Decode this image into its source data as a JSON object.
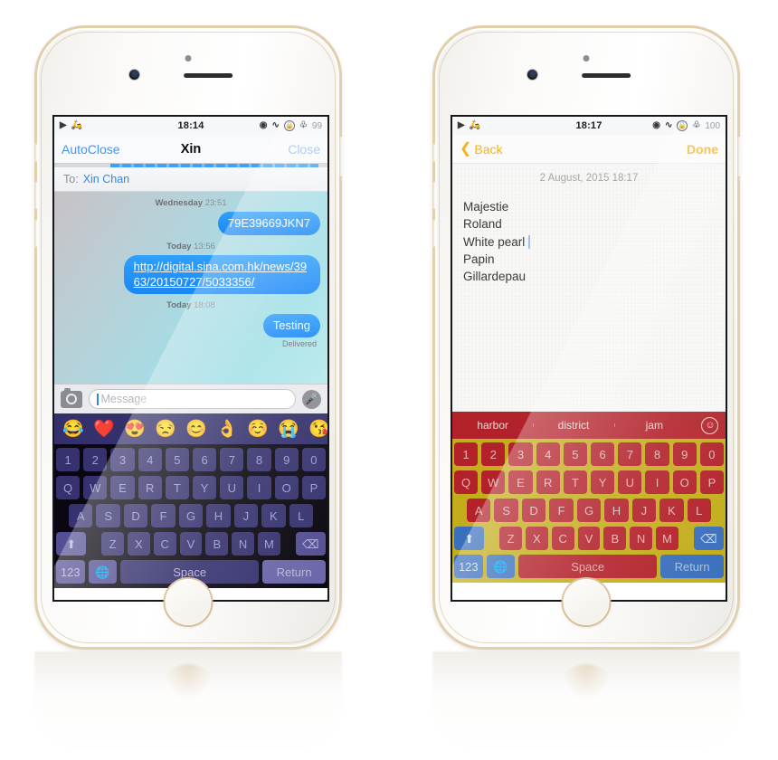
{
  "left_phone": {
    "status_bar": {
      "icons_left": [
        "location-arrow-icon",
        "scooter-icon"
      ],
      "time": "18:14",
      "icons_right": [
        "eye-icon",
        "alarm-icon",
        "rotation-lock-icon",
        "bluetooth-icon"
      ],
      "battery": "99"
    },
    "nav": {
      "left_label": "AutoClose",
      "title": "Xin",
      "right_label": "Close"
    },
    "to_field": {
      "label": "To:",
      "value": "Xin Chan"
    },
    "conversation": [
      {
        "type": "timestamp",
        "day": "Wednesday",
        "time": "23:51"
      },
      {
        "type": "message",
        "direction": "outgoing",
        "text": "79E39669JKN7",
        "link": false
      },
      {
        "type": "timestamp",
        "day": "Today",
        "time": "13:56"
      },
      {
        "type": "message",
        "direction": "outgoing",
        "text": "http://digital.sina.com.hk/news/3963/20150727/5033356/",
        "link": true
      },
      {
        "type": "timestamp",
        "day": "Today",
        "time": "18:08"
      },
      {
        "type": "message",
        "direction": "outgoing",
        "text": "Testing",
        "link": false
      }
    ],
    "delivered_label": "Delivered",
    "input_bar": {
      "camera_icon": "camera-icon",
      "placeholder": "Message",
      "mic_icon": "microphone-icon"
    },
    "emoji_row": [
      "😂",
      "❤️",
      "😍",
      "😒",
      "😊",
      "👌",
      "☺️",
      "😭",
      "😘"
    ],
    "keyboard": {
      "theme_bg": "#0a0710",
      "key_color": "#36326f",
      "rows": [
        [
          "1",
          "2",
          "3",
          "4",
          "5",
          "6",
          "7",
          "8",
          "9",
          "0"
        ],
        [
          "Q",
          "W",
          "E",
          "R",
          "T",
          "Y",
          "U",
          "I",
          "O",
          "P"
        ],
        [
          "A",
          "S",
          "D",
          "F",
          "G",
          "H",
          "J",
          "K",
          "L"
        ],
        [
          "Z",
          "X",
          "C",
          "V",
          "B",
          "N",
          "M"
        ]
      ],
      "shift_label": "shift-icon",
      "backspace_label": "backspace-icon",
      "numeric_label": "123",
      "globe_label": "globe-icon",
      "space_label": "Space",
      "return_label": "Return"
    }
  },
  "right_phone": {
    "status_bar": {
      "icons_left": [
        "location-arrow-icon",
        "scooter-icon"
      ],
      "time": "18:17",
      "icons_right": [
        "eye-icon",
        "alarm-icon",
        "rotation-lock-icon",
        "bluetooth-icon"
      ],
      "battery": "100"
    },
    "nav": {
      "back_label": "Back",
      "done_label": "Done"
    },
    "note": {
      "date": "2 August, 2015 18:17",
      "lines": [
        "Majestie",
        "Roland",
        "White pearl",
        "Papin",
        "Gillardepau"
      ],
      "caret_after_line_index": 2
    },
    "prediction_bar": {
      "words": [
        "harbor",
        "district",
        "jam"
      ],
      "emoji_button": "smiley-icon"
    },
    "keyboard": {
      "theme_bg": "#c3ad1b",
      "key_color": "#b3212a",
      "special_key_color": "#3a6fbd",
      "rows": [
        [
          "1",
          "2",
          "3",
          "4",
          "5",
          "6",
          "7",
          "8",
          "9",
          "0"
        ],
        [
          "Q",
          "W",
          "E",
          "R",
          "T",
          "Y",
          "U",
          "I",
          "O",
          "P"
        ],
        [
          "A",
          "S",
          "D",
          "F",
          "G",
          "H",
          "J",
          "K",
          "L"
        ],
        [
          "Z",
          "X",
          "C",
          "V",
          "B",
          "N",
          "M"
        ]
      ],
      "shift_label": "shift-icon",
      "backspace_label": "backspace-icon",
      "numeric_label": "123",
      "globe_label": "globe-icon",
      "space_label": "Space",
      "return_label": "Return"
    }
  }
}
